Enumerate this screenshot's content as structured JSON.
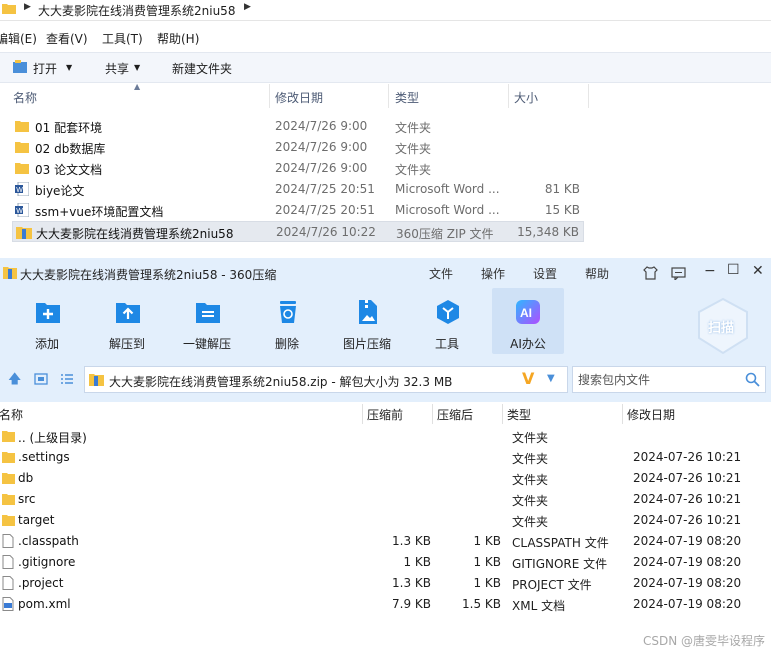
{
  "explorer": {
    "path": "大大麦影院在线消费管理系统2niu58",
    "menu": [
      "编辑(E)",
      "查看(V)",
      "工具(T)",
      "帮助(H)"
    ],
    "toolbar": {
      "open": "打开",
      "share": "共享",
      "new_folder": "新建文件夹"
    },
    "columns": {
      "name": "名称",
      "date": "修改日期",
      "type": "类型",
      "size": "大小"
    },
    "rows": [
      {
        "name": "01 配套环境",
        "date": "2024/7/26 9:00",
        "type": "文件夹",
        "size": "",
        "icon": "folder"
      },
      {
        "name": "02 db数据库",
        "date": "2024/7/26 9:00",
        "type": "文件夹",
        "size": "",
        "icon": "folder"
      },
      {
        "name": "03 论文文档",
        "date": "2024/7/26 9:00",
        "type": "文件夹",
        "size": "",
        "icon": "folder"
      },
      {
        "name": "biye论文",
        "date": "2024/7/25 20:51",
        "type": "Microsoft Word ...",
        "size": "81 KB",
        "icon": "word"
      },
      {
        "name": "ssm+vue环境配置文档",
        "date": "2024/7/25 20:51",
        "type": "Microsoft Word ...",
        "size": "15 KB",
        "icon": "word"
      },
      {
        "name": "大大麦影院在线消费管理系统2niu58",
        "date": "2024/7/26 10:22",
        "type": "360压缩 ZIP 文件",
        "size": "15,348 KB",
        "icon": "zip"
      }
    ]
  },
  "zip": {
    "title": "大大麦影院在线消费管理系统2niu58 - 360压缩",
    "menu": [
      "文件",
      "操作",
      "设置",
      "帮助"
    ],
    "tools": [
      {
        "label": "添加",
        "icon": "add-icon"
      },
      {
        "label": "解压到",
        "icon": "extract-to-icon"
      },
      {
        "label": "一键解压",
        "icon": "one-click-extract-icon"
      },
      {
        "label": "删除",
        "icon": "delete-icon"
      },
      {
        "label": "图片压缩",
        "icon": "image-compress-icon"
      },
      {
        "label": "工具",
        "icon": "tools-icon"
      },
      {
        "label": "AI办公",
        "icon": "ai-office-icon"
      }
    ],
    "scan_label": "扫描",
    "ai_badge": "AI",
    "path_text": "大大麦影院在线消费管理系统2niu58.zip - 解包大小为 32.3 MB",
    "search_placeholder": "搜索包内文件",
    "columns": {
      "name": "名称",
      "before": "压缩前",
      "after": "压缩后",
      "type": "类型",
      "date": "修改日期"
    },
    "rows": [
      {
        "name": ".. (上级目录)",
        "before": "",
        "after": "",
        "type": "文件夹",
        "date": "",
        "icon": "folder"
      },
      {
        "name": ".settings",
        "before": "",
        "after": "",
        "type": "文件夹",
        "date": "2024-07-26 10:21",
        "icon": "folder"
      },
      {
        "name": "db",
        "before": "",
        "after": "",
        "type": "文件夹",
        "date": "2024-07-26 10:21",
        "icon": "folder"
      },
      {
        "name": "src",
        "before": "",
        "after": "",
        "type": "文件夹",
        "date": "2024-07-26 10:21",
        "icon": "folder"
      },
      {
        "name": "target",
        "before": "",
        "after": "",
        "type": "文件夹",
        "date": "2024-07-26 10:21",
        "icon": "folder"
      },
      {
        "name": ".classpath",
        "before": "1.3 KB",
        "after": "1 KB",
        "type": "CLASSPATH 文件",
        "date": "2024-07-19 08:20",
        "icon": "file"
      },
      {
        "name": ".gitignore",
        "before": "1 KB",
        "after": "1 KB",
        "type": "GITIGNORE 文件",
        "date": "2024-07-19 08:20",
        "icon": "file"
      },
      {
        "name": ".project",
        "before": "1.3 KB",
        "after": "1 KB",
        "type": "PROJECT 文件",
        "date": "2024-07-19 08:20",
        "icon": "file"
      },
      {
        "name": "pom.xml",
        "before": "7.9 KB",
        "after": "1.5 KB",
        "type": "XML 文档",
        "date": "2024-07-19 08:20",
        "icon": "xml"
      }
    ]
  },
  "watermark": "CSDN @唐雯毕设程序",
  "colors": {
    "accent": "#1e88e5",
    "folder": "#f5c342",
    "window_bg": "#e3effc"
  }
}
